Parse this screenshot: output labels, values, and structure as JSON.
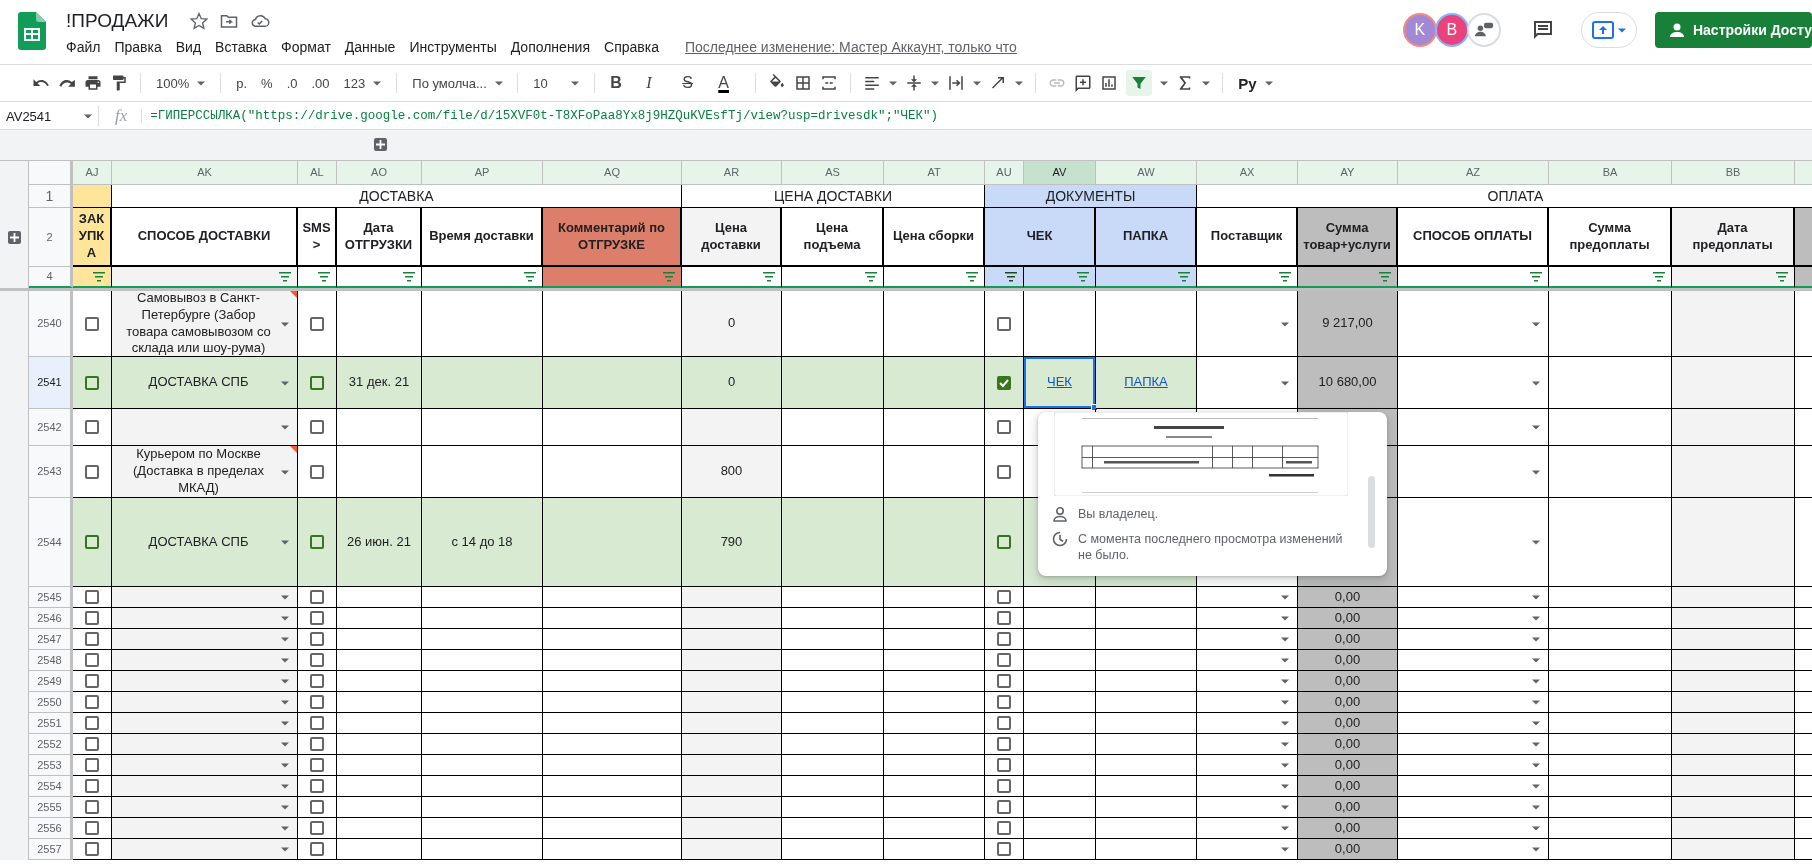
{
  "document": {
    "title": "!ПРОДАЖИ"
  },
  "menu": [
    "Файл",
    "Правка",
    "Вид",
    "Вставка",
    "Формат",
    "Данные",
    "Инструменты",
    "Дополнения",
    "Справка"
  ],
  "last_edit": "Последнее изменение: Мастер Аккаунт, только что",
  "avatars": [
    {
      "letter": "K",
      "color": "#a389d4"
    },
    {
      "letter": "B",
      "color": "#e8437d"
    }
  ],
  "share_button": "Настройки Досту",
  "toolbar": {
    "zoom": "100%",
    "currency": "р.",
    "percent": "%",
    "decrease_decimals": ".0",
    "increase_decimals": ".00",
    "more_formats": "123",
    "font": "По умолча...",
    "font_size": "10",
    "text_formats": [
      {
        "kind": "bold",
        "label": "B"
      },
      {
        "kind": "italic",
        "label": "I"
      },
      {
        "kind": "strike",
        "label": "S"
      },
      {
        "kind": "color",
        "label": "A"
      }
    ],
    "filter_on": true,
    "input_tools": "Ру"
  },
  "name_box": "AV2541",
  "function_label": "fx",
  "formula": "=ГИПЕРССЫЛКА(\"https://drive.google.com/file/d/15XVF0t-T8XFoPaa8Yx8j9HZQuKVEsfTj/view?usp=drivesdk\";\"ЧЕК\")",
  "columns": [
    {
      "letter": "AJ",
      "selected": false
    },
    {
      "letter": "AK",
      "selected": false
    },
    {
      "letter": "AL",
      "selected": false
    },
    {
      "letter": "AO",
      "selected": false
    },
    {
      "letter": "AP",
      "selected": false
    },
    {
      "letter": "AQ",
      "selected": false
    },
    {
      "letter": "AR",
      "selected": false
    },
    {
      "letter": "AS",
      "selected": false
    },
    {
      "letter": "AT",
      "selected": false
    },
    {
      "letter": "AU",
      "selected": false
    },
    {
      "letter": "AV",
      "selected": true
    },
    {
      "letter": "AW",
      "selected": false
    },
    {
      "letter": "AX",
      "selected": false
    },
    {
      "letter": "AY",
      "selected": false
    },
    {
      "letter": "AZ",
      "selected": false
    },
    {
      "letter": "BA",
      "selected": false
    },
    {
      "letter": "BB",
      "selected": false
    }
  ],
  "header_row_numbers": [
    "1",
    "2",
    "4"
  ],
  "groups": [
    "ДОСТАВКА",
    "ЦЕНА ДОСТАВКИ",
    "ДОКУМЕНТЫ",
    "ОПЛАТА"
  ],
  "field_headers": [
    "ЗАКУПКА",
    "СПОСОБ ДОСТАВКИ",
    "SMS >",
    "Дата ОТГРУЗКИ",
    "Время доставки",
    "Комментарий по ОТГРУЗКЕ",
    "Цена доставки",
    "Цена подъема",
    "Цена сборки",
    "ЧЕК",
    "ПАПКА",
    "Поставщик",
    "Сумма товар+услуги",
    "СПОСОБ ОПЛАТЫ",
    "Сумма предоплаты",
    "Дата предоплаты"
  ],
  "rows": [
    {
      "number": "2540",
      "selected": false,
      "highlighted": false,
      "purchase_checked": false,
      "delivery_method": "Самовывоз в Санкт-Петербурге (Забор товара самовывозом со склада или шоу-рума)",
      "has_note": true,
      "sms_checked": false,
      "delivery_price": "0",
      "receipt_checked": false,
      "supplier_dropdown": true,
      "total": "9 217,00"
    },
    {
      "number": "2541",
      "selected": true,
      "highlighted": true,
      "purchase_checked": false,
      "delivery_method": "ДОСТАВКА СПБ",
      "has_note": false,
      "sms_checked": false,
      "ship_date": "31 дек. 21",
      "delivery_price": "0",
      "receipt_checked": true,
      "receipt_link": "ЧЕК",
      "folder_link": "ПАПКА",
      "supplier_dropdown": true,
      "total": "10 680,00"
    },
    {
      "number": "2542",
      "selected": false,
      "highlighted": false,
      "purchase_checked": false,
      "has_note": false,
      "sms_checked": false,
      "receipt_checked": false,
      "supplier_dropdown": false
    },
    {
      "number": "2543",
      "selected": false,
      "highlighted": false,
      "purchase_checked": false,
      "delivery_method": "Курьером по Москве (Доставка в пределах МКАД)",
      "has_note": true,
      "sms_checked": false,
      "delivery_price": "800",
      "receipt_checked": false,
      "supplier_dropdown": false
    },
    {
      "number": "2544",
      "selected": false,
      "highlighted": true,
      "purchase_checked": false,
      "delivery_method": "ДОСТАВКА СПБ",
      "has_note": false,
      "sms_checked": false,
      "ship_date": "26 июн. 21",
      "delivery_time": "с 14 до 18",
      "delivery_price": "790",
      "receipt_checked": false,
      "supplier_dropdown": false
    },
    {
      "number": "2545",
      "selected": false,
      "highlighted": false,
      "purchase_checked": false,
      "has_note": false,
      "sms_checked": false,
      "receipt_checked": false,
      "supplier_dropdown": true,
      "total": "0,00"
    },
    {
      "number": "2546",
      "selected": false,
      "highlighted": false,
      "purchase_checked": false,
      "has_note": false,
      "sms_checked": false,
      "receipt_checked": false,
      "supplier_dropdown": true,
      "total": "0,00"
    },
    {
      "number": "2547",
      "selected": false,
      "highlighted": false,
      "purchase_checked": false,
      "has_note": false,
      "sms_checked": false,
      "receipt_checked": false,
      "supplier_dropdown": true,
      "total": "0,00"
    },
    {
      "number": "2548",
      "selected": false,
      "highlighted": false,
      "purchase_checked": false,
      "has_note": false,
      "sms_checked": false,
      "receipt_checked": false,
      "supplier_dropdown": true,
      "total": "0,00"
    },
    {
      "number": "2549",
      "selected": false,
      "highlighted": false,
      "purchase_checked": false,
      "has_note": false,
      "sms_checked": false,
      "receipt_checked": false,
      "supplier_dropdown": true,
      "total": "0,00"
    },
    {
      "number": "2550",
      "selected": false,
      "highlighted": false,
      "purchase_checked": false,
      "has_note": false,
      "sms_checked": false,
      "receipt_checked": false,
      "supplier_dropdown": true,
      "total": "0,00"
    },
    {
      "number": "2551",
      "selected": false,
      "highlighted": false,
      "purchase_checked": false,
      "has_note": false,
      "sms_checked": false,
      "receipt_checked": false,
      "supplier_dropdown": true,
      "total": "0,00"
    },
    {
      "number": "2552",
      "selected": false,
      "highlighted": false,
      "purchase_checked": false,
      "has_note": false,
      "sms_checked": false,
      "receipt_checked": false,
      "supplier_dropdown": true,
      "total": "0,00"
    },
    {
      "number": "2553",
      "selected": false,
      "highlighted": false,
      "purchase_checked": false,
      "has_note": false,
      "sms_checked": false,
      "receipt_checked": false,
      "supplier_dropdown": true,
      "total": "0,00"
    },
    {
      "number": "2554",
      "selected": false,
      "highlighted": false,
      "purchase_checked": false,
      "has_note": false,
      "sms_checked": false,
      "receipt_checked": false,
      "supplier_dropdown": true,
      "total": "0,00"
    },
    {
      "number": "2555",
      "selected": false,
      "highlighted": false,
      "purchase_checked": false,
      "has_note": false,
      "sms_checked": false,
      "receipt_checked": false,
      "supplier_dropdown": true,
      "total": "0,00"
    },
    {
      "number": "2556",
      "selected": false,
      "highlighted": false,
      "purchase_checked": false,
      "has_note": false,
      "sms_checked": false,
      "receipt_checked": false,
      "supplier_dropdown": true,
      "total": "0,00"
    },
    {
      "number": "2557",
      "selected": false,
      "highlighted": false,
      "purchase_checked": false,
      "has_note": false,
      "sms_checked": false,
      "receipt_checked": false,
      "supplier_dropdown": true,
      "total": "0,00"
    }
  ],
  "link_preview": {
    "owner": "Вы владелец.",
    "activity": "С момента последнего просмотра изменений не было."
  }
}
